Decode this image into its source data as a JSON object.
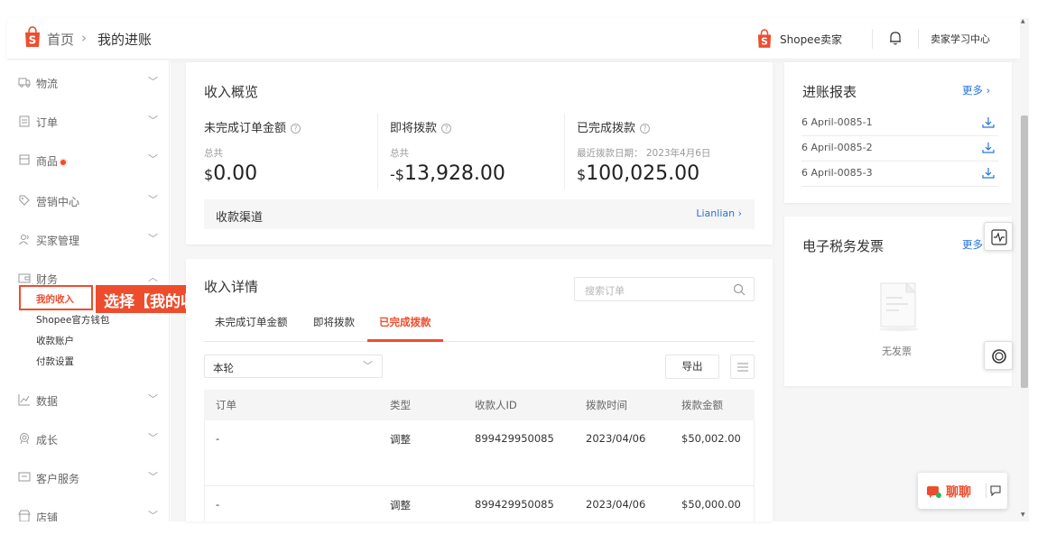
{
  "header": {
    "breadcrumb_home": "首页",
    "breadcrumb_sep": "›",
    "breadcrumb_current": "我的进账",
    "brand": "Shopee卖家",
    "learning_center": "卖家学习中心"
  },
  "sidebar": {
    "items": [
      {
        "label": "物流",
        "icon": "truck-icon"
      },
      {
        "label": "订单",
        "icon": "clipboard-icon"
      },
      {
        "label": "商品",
        "icon": "box-icon"
      },
      {
        "label": "营销中心",
        "icon": "tag-icon"
      },
      {
        "label": "买家管理",
        "icon": "users-icon"
      },
      {
        "label": "财务",
        "icon": "wallet-icon"
      },
      {
        "label": "数据",
        "icon": "chart-icon"
      },
      {
        "label": "成长",
        "icon": "medal-icon"
      },
      {
        "label": "客户服务",
        "icon": "chat-icon"
      },
      {
        "label": "店铺",
        "icon": "store-icon"
      }
    ],
    "finance_sub": [
      "我的收入",
      "Shopee官方钱包",
      "收款账户",
      "付款设置"
    ],
    "callout": "选择【我的收入】"
  },
  "summary": {
    "title": "收入概览",
    "col1": {
      "label": "未完成订单金额",
      "sub": "总共",
      "currency": "$",
      "amount": "0.00"
    },
    "col2": {
      "label": "即将拨款",
      "sub": "总共",
      "currency": "-$",
      "amount": "13,928.00"
    },
    "col3": {
      "label": "已完成拨款",
      "sub": "最近拨款日期： 2023年4月6日",
      "currency": "$",
      "amount": "100,025.00"
    },
    "channel_label": "收款渠道",
    "channel_link": "Lianlian ›"
  },
  "details": {
    "title": "收入详情",
    "search_placeholder": "搜索订单",
    "tabs": [
      "未完成订单金额",
      "即将拨款",
      "已完成拨款"
    ],
    "period": "本轮",
    "export": "导出",
    "columns": [
      "订单",
      "类型",
      "收款人ID",
      "拨款时间",
      "拨款金额"
    ],
    "rows": [
      [
        "-",
        "调整",
        "899429950085",
        "2023/04/06",
        "$50,002.00"
      ],
      [
        "-",
        "调整",
        "899429950085",
        "2023/04/06",
        "$50,000.00"
      ]
    ]
  },
  "reports": {
    "title": "进账报表",
    "more": "更多 ›",
    "items": [
      "6 April-0085-1",
      "6 April-0085-2",
      "6 April-0085-3"
    ]
  },
  "invoice": {
    "title": "电子税务发票",
    "more": "更多",
    "empty": "无发票"
  },
  "chat": {
    "label": "聊聊"
  },
  "colors": {
    "accent": "#ee4d2d",
    "link": "#2673dd"
  }
}
